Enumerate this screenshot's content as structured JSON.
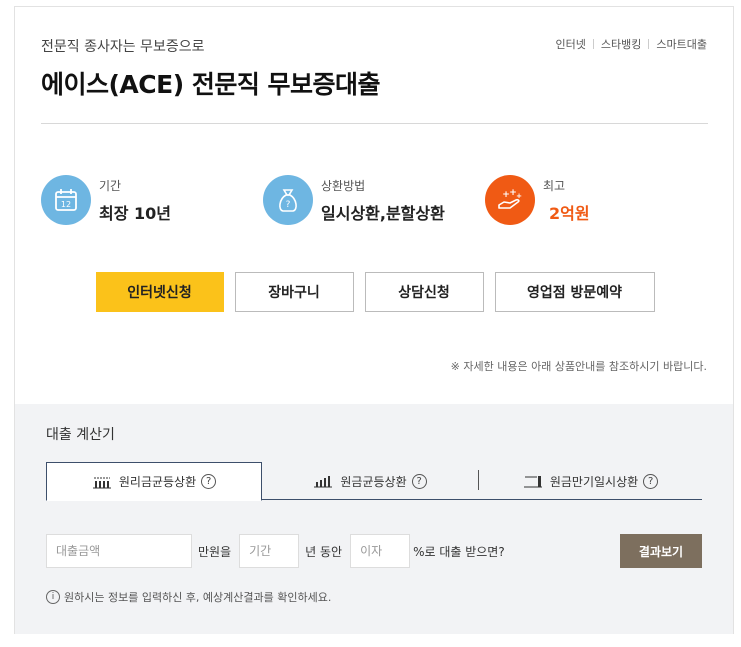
{
  "header": {
    "subtitle": "전문직 종사자는 무보증으로",
    "title": "에이스(ACE) 전문직 무보증대출",
    "links": [
      "인터넷",
      "스타뱅킹",
      "스마트대출"
    ]
  },
  "info": {
    "period": {
      "label": "기간",
      "value": "최장 10년",
      "icon": "calendar-icon"
    },
    "repay": {
      "label": "상환방법",
      "value": "일시상환,분할상환",
      "icon": "money-bag-icon"
    },
    "max": {
      "label": "최고",
      "value": "2억원",
      "icon": "hand-coins-icon"
    }
  },
  "actions": {
    "internet_apply": "인터넷신청",
    "cart": "장바구니",
    "consult": "상담신청",
    "branch_visit": "영업점 방문예약"
  },
  "notice": "※ 자세한 내용은 아래 상품안내를 참조하시기 바랍니다.",
  "calculator": {
    "title": "대출 계산기",
    "tabs": [
      "원리금균등상환",
      "원금균등상환",
      "원금만기일시상환"
    ],
    "help_glyph": "?",
    "amount_placeholder": "대출금액",
    "amount_unit": "만원을",
    "period_placeholder": "기간",
    "period_unit": "년 동안",
    "rate_placeholder": "이자",
    "rate_unit": "%로 대출 받으면?",
    "result_button": "결과보기",
    "hint_glyph": "i",
    "hint": "원하시는 정보를 입력하신 후, 예상계산결과를 확인하세요."
  },
  "colors": {
    "primary_yellow": "#fbc21a",
    "info_blue": "#6eb6e2",
    "accent_orange": "#f05a14",
    "result_brown": "#7d6f5e",
    "tab_navy": "#3d4f6b"
  }
}
